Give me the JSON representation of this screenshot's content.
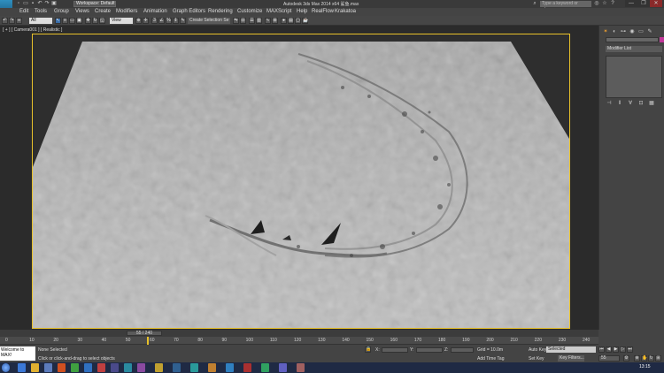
{
  "window": {
    "title": "Autodesk 3ds Max  2014 x64      鲨鱼.max",
    "workspace": "Workspace: Default",
    "search_placeholder": "Type a keyword or phrase",
    "controls": [
      "—",
      "❐",
      "✕"
    ]
  },
  "menu": [
    "Edit",
    "Tools",
    "Group",
    "Views",
    "Create",
    "Modifiers",
    "Animation",
    "Graph Editors",
    "Rendering",
    "Customize",
    "MAXScript",
    "Help",
    "RealFlow",
    "Krakatoa"
  ],
  "toolbar": {
    "selection_filter": "All",
    "reference_coord": "View",
    "selection_set": "Create Selection Se"
  },
  "viewport": {
    "label": "[ + ] [ Camera001 ] [ Realistic ]",
    "accent": "#e8c12a"
  },
  "command_panel": {
    "modifier_list": "Modifier List",
    "object_color": "#c3369a"
  },
  "timeline": {
    "frame_display": "55 / 240",
    "ticks": [
      "0",
      "10",
      "20",
      "30",
      "40",
      "50",
      "60",
      "70",
      "80",
      "90",
      "100",
      "110",
      "120",
      "130",
      "140",
      "150",
      "160",
      "170",
      "180",
      "190",
      "200",
      "210",
      "220",
      "230",
      "240"
    ]
  },
  "status": {
    "listener": "Welcome to MAX!",
    "selection": "None Selected",
    "hint": "Click or click-and-drag to select objects",
    "x_label": "X:",
    "y_label": "Y:",
    "z_label": "Z:",
    "grid": "Grid = 10.0m",
    "add_time_tag": "Add Time Tag",
    "auto_key": "Auto Key",
    "set_key": "Set Key",
    "selected_dropdown": "Selected",
    "key_filters": "Key Filters...",
    "current_frame": "55"
  },
  "taskbar": {
    "clock": "13:15"
  }
}
